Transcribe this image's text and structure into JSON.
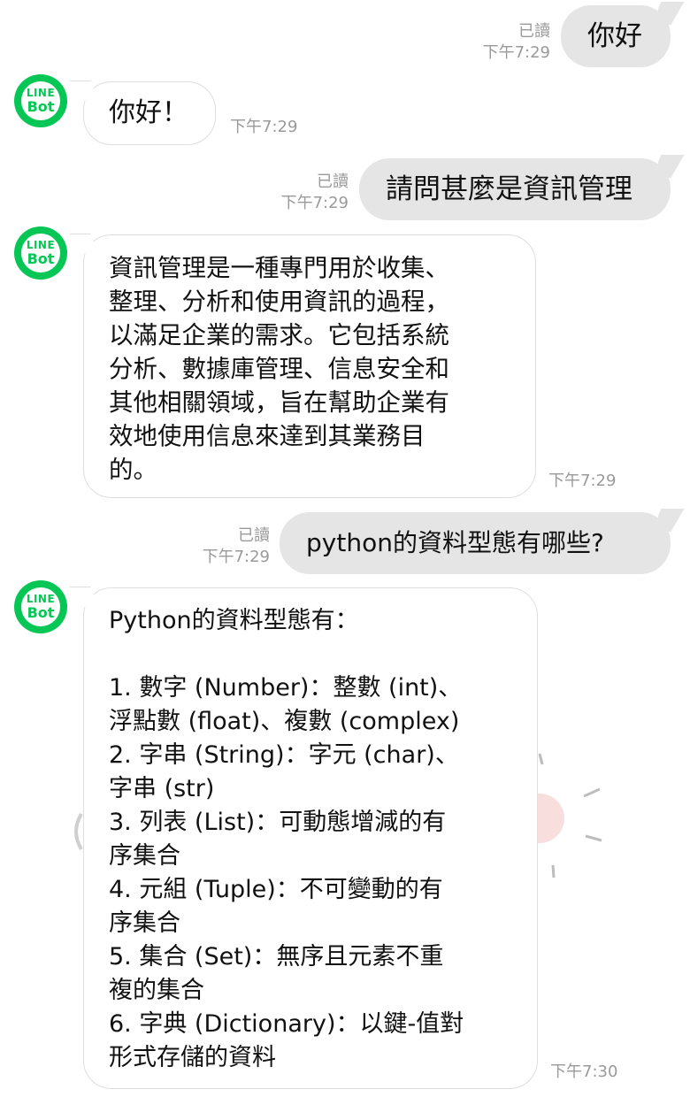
{
  "messages": [
    {
      "side": "out",
      "read": "已讀",
      "time": "下午7:29",
      "text": "你好"
    },
    {
      "side": "in",
      "avatar_line1": "LINE",
      "avatar_line2": "Bot",
      "text": "你好！",
      "time": "下午7:29"
    },
    {
      "side": "out",
      "read": "已讀",
      "time": "下午7:29",
      "text": "請問甚麼是資訊管理"
    },
    {
      "side": "in",
      "avatar_line1": "LINE",
      "avatar_line2": "Bot",
      "text": "資訊管理是一種專門用於收集、\n整理、分析和使用資訊的過程，\n以滿足企業的需求。它包括系統\n分析、數據庫管理、信息安全和\n其他相關領域，旨在幫助企業有\n效地使用信息來達到其業務目\n的。",
      "time": "下午7:29"
    },
    {
      "side": "out",
      "read": "已讀",
      "time": "下午7:29",
      "text": "python的資料型態有哪些?"
    },
    {
      "side": "in",
      "avatar_line1": "LINE",
      "avatar_line2": "Bot",
      "text": "Python的資料型態有：\n\n1. 數字 (Number)：整數 (int)、\n浮點數 (float)、複數 (complex)\n2. 字串 (String)：字元 (char)、\n字串 (str)\n3. 列表 (List)：可動態增減的有\n序集合\n4. 元組 (Tuple)：不可變動的有\n序集合\n5. 集合 (Set)：無序且元素不重\n複的集合\n6. 字典 (Dictionary)：以鍵-值對\n形式存儲的資料",
      "time": "下午7:30"
    }
  ],
  "colors": {
    "avatar_green": "#06c755",
    "out_bubble": "#e5e5e5",
    "meta": "#9a9a9a"
  }
}
